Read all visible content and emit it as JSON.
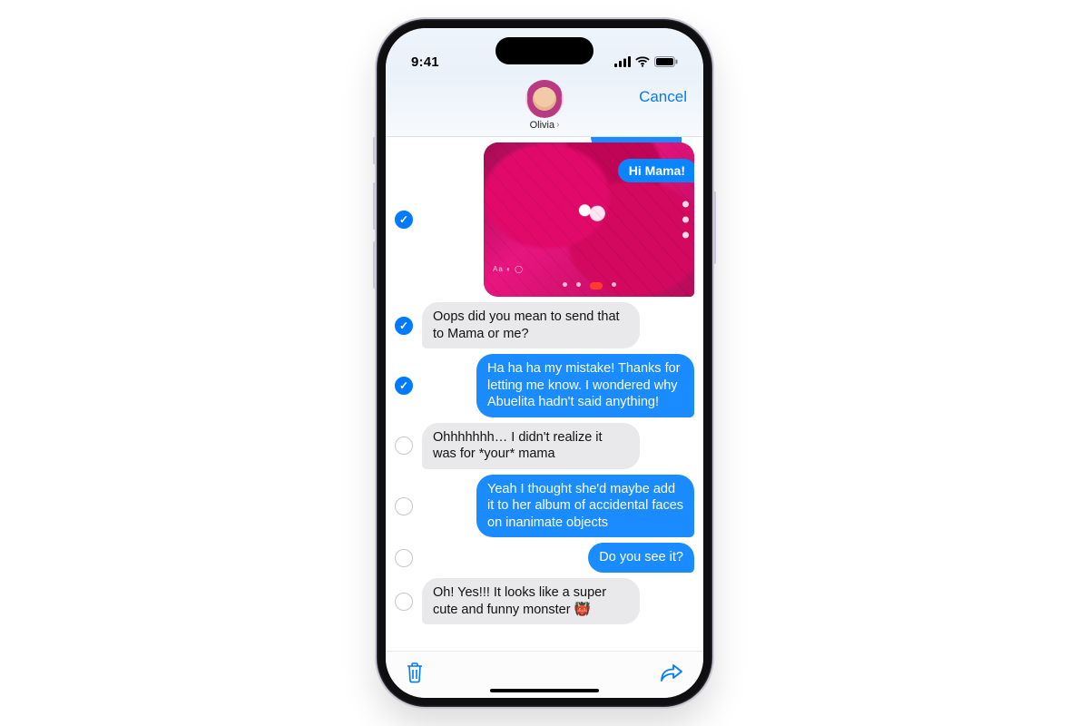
{
  "status": {
    "time": "9:41"
  },
  "header": {
    "contact_name": "Olivia",
    "cancel_label": "Cancel"
  },
  "image_message": {
    "checked": true,
    "caption": "Hi Mama!"
  },
  "messages": [
    {
      "side": "recv",
      "checked": true,
      "text": "Oops did you mean to send that to Mama or me?"
    },
    {
      "side": "sent",
      "checked": true,
      "text": "Ha ha ha my mistake! Thanks for letting me know. I wondered why Abuelita hadn't said anything!"
    },
    {
      "side": "recv",
      "checked": false,
      "text": "Ohhhhhhh… I didn't realize it was for *your* mama"
    },
    {
      "side": "sent",
      "checked": false,
      "text": "Yeah I thought she'd maybe add it to her album of accidental faces on inanimate objects"
    },
    {
      "side": "sent",
      "checked": false,
      "text": "Do you see it?"
    },
    {
      "side": "recv",
      "checked": false,
      "text": "Oh! Yes!!! It looks like a super cute and funny monster 👹"
    }
  ],
  "toolbar": {
    "delete_label": "Delete",
    "forward_label": "Forward"
  }
}
